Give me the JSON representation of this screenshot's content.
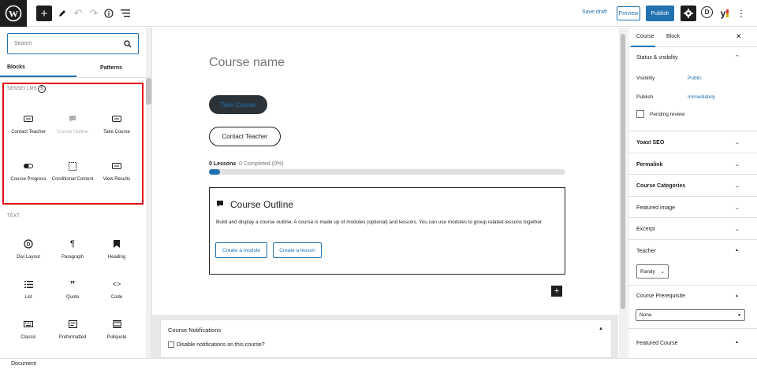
{
  "toolbar": {
    "save_draft": "Save draft",
    "preview": "Preview",
    "publish": "Publish",
    "divi_letter": "D",
    "yoast_letter": "y"
  },
  "inserter": {
    "search_placeholder": "Search",
    "tabs": [
      "Blocks",
      "Patterns"
    ],
    "sensei_category": "SENSEI LMS",
    "sensei_blocks": [
      {
        "label": "Contact Teacher",
        "icon": "contact-teacher-icon",
        "disabled": false
      },
      {
        "label": "Course Outline",
        "icon": "course-outline-icon",
        "disabled": true
      },
      {
        "label": "Take Course",
        "icon": "take-course-icon",
        "disabled": false
      },
      {
        "label": "Course Progress",
        "icon": "course-progress-icon",
        "disabled": false
      },
      {
        "label": "Conditional Content",
        "icon": "conditional-content-icon",
        "disabled": false
      },
      {
        "label": "View Results",
        "icon": "view-results-icon",
        "disabled": false
      }
    ],
    "text_category": "TEXT",
    "text_blocks": [
      {
        "label": "Divi Layout",
        "icon": "divi-icon"
      },
      {
        "label": "Paragraph",
        "icon": "paragraph-icon"
      },
      {
        "label": "Heading",
        "icon": "heading-icon"
      },
      {
        "label": "List",
        "icon": "list-icon"
      },
      {
        "label": "Quote",
        "icon": "quote-icon"
      },
      {
        "label": "Code",
        "icon": "code-icon"
      },
      {
        "label": "Classic",
        "icon": "classic-icon"
      },
      {
        "label": "Preformatted",
        "icon": "preformatted-icon"
      },
      {
        "label": "Pullquote",
        "icon": "pullquote-icon"
      }
    ]
  },
  "canvas": {
    "course_name": "Course name",
    "take_course": "Take Course",
    "contact_teacher": "Contact Teacher",
    "lessons_count": "0 Lessons",
    "completed": "0 Completed (0%)",
    "progress": 0.02,
    "outline_title": "Course Outline",
    "outline_desc": "Build and display a course outline. A course is made up of modules (optional) and lessons. You can use modules to group related lessons together.",
    "create_module": "Create a module",
    "create_lesson": "Create a lesson",
    "notifications_title": "Course Notifications",
    "disable_notifications": "Disable notifications on this course?"
  },
  "sidebar": {
    "tabs": [
      "Course",
      "Block"
    ],
    "status_title": "Status & visibility",
    "visibility_label": "Visibility",
    "visibility_value": "Public",
    "publish_label": "Publish",
    "publish_value": "Immediately",
    "pending_review": "Pending review",
    "sections": [
      "Yoast SEO",
      "Permalink",
      "Course Categories",
      "Featured image",
      "Excerpt"
    ],
    "teacher_title": "Teacher",
    "teacher_value": "Randy",
    "prereq_title": "Course Prerequisite",
    "prereq_value": "None",
    "featured_title": "Featured Course"
  },
  "footer": {
    "breadcrumb": "Document"
  },
  "colors": {
    "accent": "#2271b1",
    "highlight": "#e0000f",
    "dark": "#1e1e1e"
  }
}
